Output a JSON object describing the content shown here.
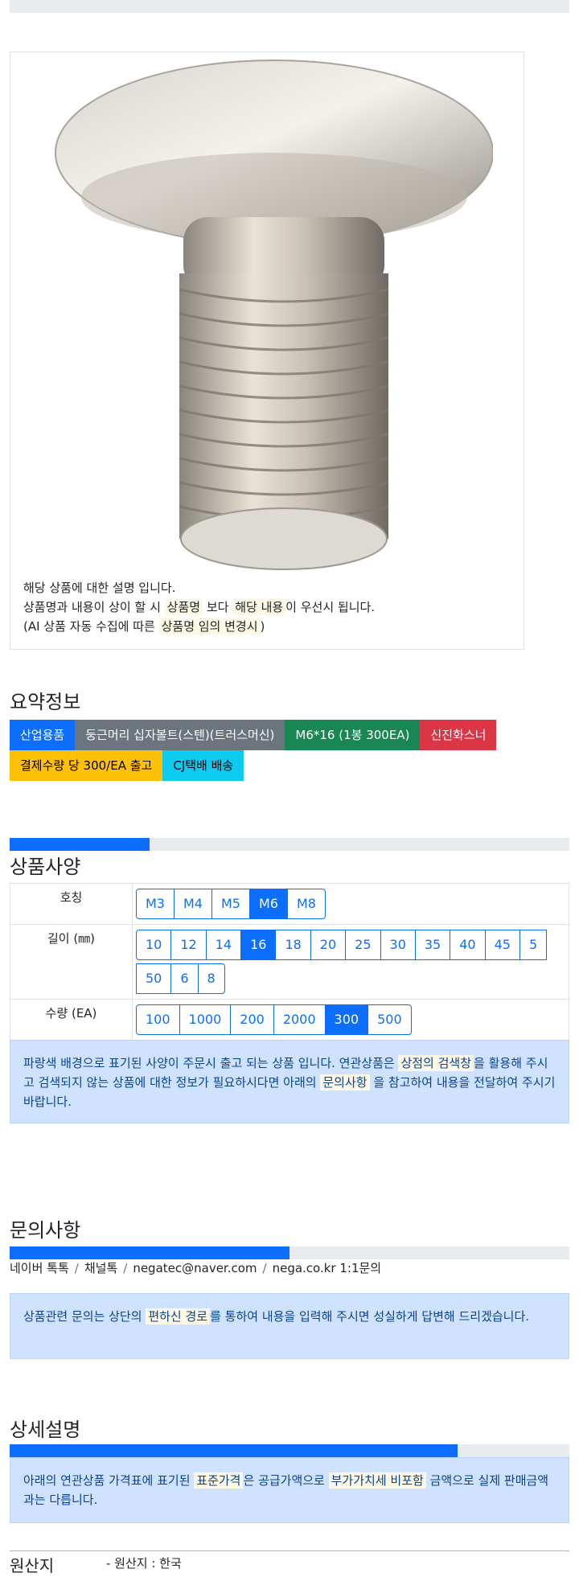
{
  "product": {
    "image_alt": "둥근머리 십자볼트(스텐)(트러스머신)",
    "desc_line1": "해당 상품에 대한 설명 입니다.",
    "desc_line2_a": "상품명과 내용이 상이 할 시 ",
    "desc_line2_mark1": "상품명",
    "desc_line2_b": " 보다 ",
    "desc_line2_mark2": "해당 내용",
    "desc_line2_c": "이 우선시 됩니다.",
    "desc_line3_a": "(AI 상품 자동 수집에 따른 ",
    "desc_line3_mark": "상품명 임의 변경시",
    "desc_line3_b": ")"
  },
  "summary": {
    "title": "요약정보",
    "badges": [
      "산업용품",
      "둥근머리 십자볼트(스텐)(트러스머신)",
      "M6*16 (1봉 300EA)",
      "신진화스너",
      "결제수량 당 300/EA 출고",
      "CJ택배 배송"
    ]
  },
  "specs": {
    "progress_fraction": 0.25,
    "title": "상품사양",
    "rows": [
      {
        "label": "호칭",
        "options": [
          "M3",
          "M4",
          "M5",
          "M6",
          "M8"
        ],
        "selected": "M6"
      },
      {
        "label": "길이 (㎜)",
        "options": [
          "10",
          "12",
          "14",
          "16",
          "18",
          "20",
          "25",
          "30",
          "35",
          "40",
          "45",
          "5",
          "50",
          "6",
          "8"
        ],
        "selected": "16"
      },
      {
        "label": "수량 (EA)",
        "options": [
          "100",
          "1000",
          "200",
          "2000",
          "300",
          "500"
        ],
        "selected": "300"
      }
    ],
    "notice_a": "파랑색 배경으로 표기된 사양이 주문시 출고 되는 상품 입니다. 연관상품은 ",
    "notice_mark1": "상점의 검색창",
    "notice_b": "을 활용해 주시고 검색되지 않는 상품에 대한 정보가 필요하시다면 아래의 ",
    "notice_mark2": "문의사항",
    "notice_c": " 을 참고하여 내용을 전달하여 주시기 바랍니다."
  },
  "inquiry": {
    "title": "문의사항",
    "progress_fraction": 0.5,
    "links": [
      "네이버 톡톡",
      "채널톡",
      "negatec@naver.com",
      "nega.co.kr 1:1문의"
    ],
    "separator": "/",
    "notice_a": "상품관련 문의는 상단의 ",
    "notice_mark": "편하신 경로",
    "notice_b": "를 통하여 내용을 입력해 주시면 성실하게 답변해 드리겠습니다."
  },
  "detail": {
    "title": "상세설명",
    "progress_fraction": 0.8,
    "notice_a": "아래의 연관상품 가격표에 표기된 ",
    "notice_mark1": "표준가격",
    "notice_b": "은 공급가액으로 ",
    "notice_mark2": "부가가치세 비포함",
    "notice_c": " 금액으로 실제 판매금액과는 다릅니다."
  },
  "origin": {
    "label": "원산지",
    "value": "- 원산지 : 한국"
  },
  "colors": {
    "primary": "#0d6efd",
    "secondary": "#6c757d",
    "success": "#198754",
    "danger": "#dc3545",
    "warning": "#ffc107",
    "info": "#0dcaf0",
    "alert_bg": "#cfe2ff"
  }
}
